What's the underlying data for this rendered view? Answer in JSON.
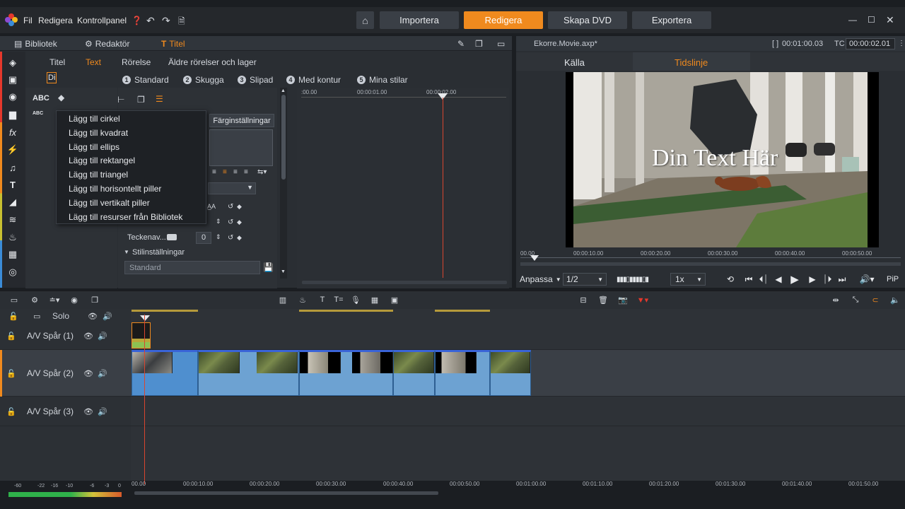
{
  "menubar": {
    "items": [
      "Fil",
      "Redigera",
      "Kontrollpanel"
    ]
  },
  "modes": {
    "home": "home-icon",
    "tabs": [
      "Importera",
      "Redigera",
      "Skapa DVD",
      "Exportera"
    ],
    "active": "Redigera"
  },
  "left_panel": {
    "tabs": [
      "Bibliotek",
      "Redaktör",
      "Titel"
    ],
    "subtabs": [
      "Titel",
      "Text",
      "Rörelse",
      "Äldre rörelser och lager"
    ],
    "style_options": [
      {
        "num": "1",
        "label": "Standard"
      },
      {
        "num": "2",
        "label": "Skugga"
      },
      {
        "num": "3",
        "label": "Slipad"
      },
      {
        "num": "4",
        "label": "Med kontur"
      },
      {
        "num": "5",
        "label": "Mina stilar"
      }
    ],
    "abc_label": "ABC",
    "layer_field": "Di",
    "color_button": "Färginställningar",
    "teckenav_label": "Teckenav...",
    "teckenav_value": "0",
    "stil_header": "Stilinställningar",
    "stil_value": "Standard",
    "mini_ticks": [
      ":00.00",
      "00:00:01.00",
      "00:00:02.00"
    ]
  },
  "dropdown": {
    "items": [
      "Lägg till cirkel",
      "Lägg till kvadrat",
      "Lägg till ellips",
      "Lägg till rektangel",
      "Lägg till triangel",
      "Lägg till horisontellt piller",
      "Lägg till vertikalt piller",
      "Lägg till resurser från Bibliotek"
    ]
  },
  "preview": {
    "filename": "Ekorre.Movie.axp*",
    "timecode": "00:01:00.03",
    "tc_label": "TC",
    "tc_value": "00:00:02.01",
    "tabs": [
      "Källa",
      "Tidslinje"
    ],
    "active_tab": "Tidslinje",
    "overlay_text": "Din Text Här",
    "ruler_ticks": [
      "00.00",
      "00:00:10.00",
      "00:00:20.00",
      "00:00:30.00",
      "00:00:40.00",
      "00:00:50.00"
    ],
    "fit_label": "Anpassa",
    "ratio_label": "1/2",
    "speed_label": "1x",
    "pip_label": "PiP"
  },
  "timeline": {
    "solo_label": "Solo",
    "tracks": [
      {
        "name": "A/V Spår (1)"
      },
      {
        "name": "A/V Spår (2)"
      },
      {
        "name": "A/V Spår (3)"
      }
    ],
    "ticks": [
      "00.00",
      "00:00:10.00",
      "00:00:20.00",
      "00:00:30.00",
      "00:00:40.00",
      "00:00:50.00",
      "00:01:00.00",
      "00:01:10.00",
      "00:01:20.00",
      "00:01:30.00",
      "00:01:40.00",
      "00:01:50.00"
    ],
    "meter_labels": [
      "-60",
      "-22",
      "-16",
      "-10",
      "-6",
      "-3",
      "0"
    ]
  }
}
